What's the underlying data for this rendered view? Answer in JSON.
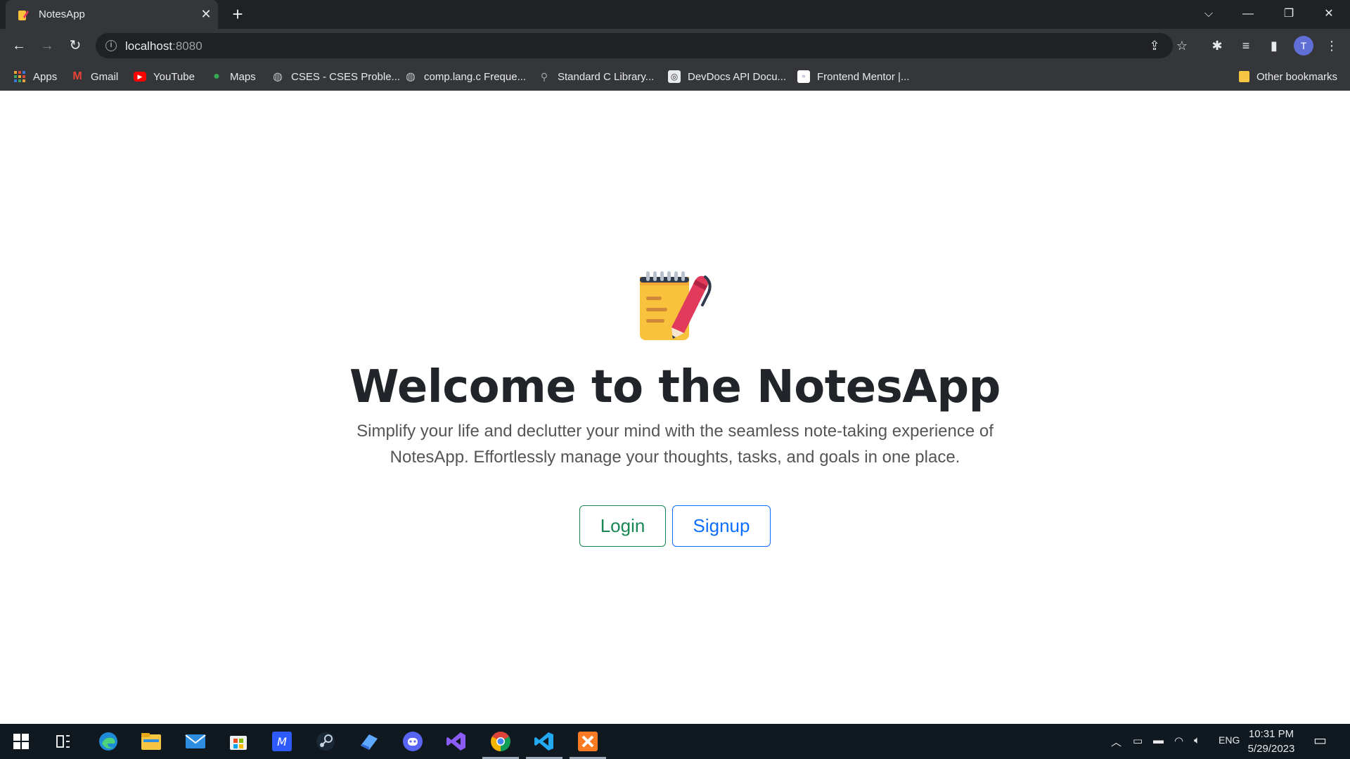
{
  "tab": {
    "title": "NotesApp",
    "close": "✕",
    "new_tab": "+"
  },
  "window_controls": {
    "dropdown": "⌵",
    "minimize": "—",
    "restore": "❐",
    "close": "✕"
  },
  "toolbar": {
    "back": "←",
    "forward": "→",
    "reload": "↻",
    "url_host": "localhost",
    "url_port": ":8080",
    "profile_initial": "T"
  },
  "bookmarks": [
    {
      "label": "Apps",
      "icon": "apps-grid-icon"
    },
    {
      "label": "Gmail",
      "icon": "gmail-icon"
    },
    {
      "label": "YouTube",
      "icon": "youtube-icon"
    },
    {
      "label": "Maps",
      "icon": "maps-icon"
    },
    {
      "label": "CSES - CSES Proble...",
      "icon": "globe-icon"
    },
    {
      "label": "comp.lang.c Freque...",
      "icon": "globe-icon"
    },
    {
      "label": "Standard C Library...",
      "icon": "bike-icon"
    },
    {
      "label": "DevDocs API Docu...",
      "icon": "devdocs-icon"
    },
    {
      "label": "Frontend Mentor |...",
      "icon": "frontend-mentor-icon"
    }
  ],
  "other_bookmarks": "Other bookmarks",
  "hero": {
    "title": "Welcome to the NotesApp",
    "subtitle": "Simplify your life and declutter your mind with the seamless note-taking experience of NotesApp. Effortlessly manage your thoughts, tasks, and goals in one place.",
    "login_label": "Login",
    "signup_label": "Signup"
  },
  "taskbar": {
    "language": "ENG",
    "time": "10:31 PM",
    "date": "5/29/2023"
  },
  "colors": {
    "login": "#198754",
    "signup": "#0d6efd",
    "title": "#212529"
  }
}
